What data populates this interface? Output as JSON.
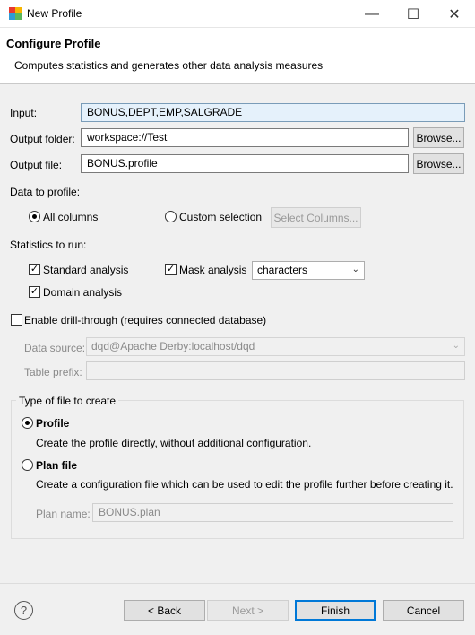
{
  "window": {
    "title": "New Profile",
    "controls": {
      "minimize": "—",
      "maximize": "☐",
      "close": "✕"
    }
  },
  "header": {
    "title": "Configure Profile",
    "description": "Computes statistics and generates other data analysis measures"
  },
  "form": {
    "input_label": "Input:",
    "input_value": "BONUS,DEPT,EMP,SALGRADE",
    "output_folder_label": "Output folder:",
    "output_folder_value": "workspace://Test",
    "output_file_label": "Output file:",
    "output_file_value": "BONUS.profile",
    "browse_label": "Browse..."
  },
  "data_to_profile": {
    "label": "Data to profile:",
    "all_columns": "All columns",
    "custom_selection": "Custom selection",
    "select_columns_button": "Select Columns...",
    "selected": "all_columns"
  },
  "statistics": {
    "label": "Statistics to run:",
    "standard_analysis": "Standard analysis",
    "mask_analysis": "Mask analysis",
    "mask_type": "characters",
    "domain_analysis": "Domain analysis",
    "standard_checked": true,
    "mask_checked": true,
    "domain_checked": true
  },
  "drill_through": {
    "label": "Enable drill-through (requires connected database)",
    "checked": false,
    "data_source_label": "Data source:",
    "data_source_value": "dqd@Apache Derby:localhost/dqd",
    "table_prefix_label": "Table prefix:",
    "table_prefix_value": ""
  },
  "file_type": {
    "legend": "Type of file to create",
    "profile_label": "Profile",
    "profile_desc": "Create the profile directly, without additional configuration.",
    "plan_label": "Plan file",
    "plan_desc": "Create a configuration file which can be used to edit the profile further before creating it.",
    "plan_name_label": "Plan name:",
    "plan_name_value": "BONUS.plan",
    "selected": "profile"
  },
  "footer": {
    "help_icon": "?",
    "back_label": "< Back",
    "next_label": "Next >",
    "finish_label": "Finish",
    "cancel_label": "Cancel"
  }
}
